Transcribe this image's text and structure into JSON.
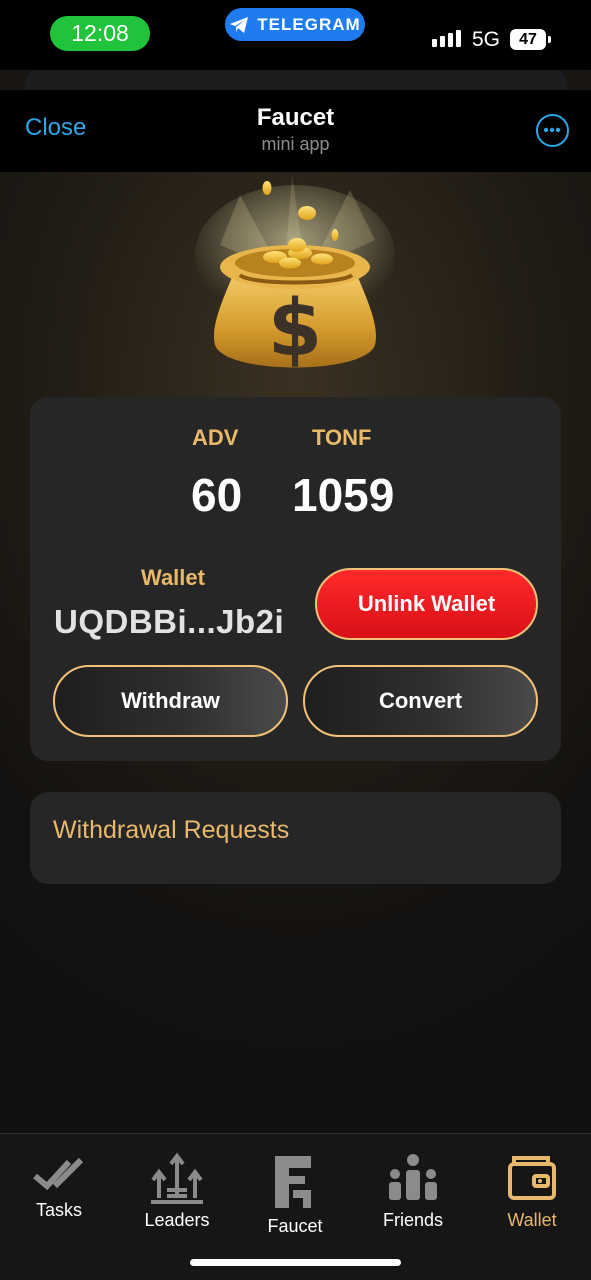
{
  "status_bar": {
    "time": "12:08",
    "telegram_label": "TELEGRAM",
    "network": "5G",
    "battery": "47"
  },
  "header": {
    "close_label": "Close",
    "title": "Faucet",
    "subtitle": "mini app",
    "more_icon": "more-dots-icon"
  },
  "balances": {
    "adv": {
      "label": "ADV",
      "value": "60"
    },
    "tonf": {
      "label": "TONF",
      "value": "1059"
    }
  },
  "wallet": {
    "label": "Wallet",
    "address": "UQDBBi...Jb2i",
    "unlink_label": "Unlink Wallet"
  },
  "actions": {
    "withdraw_label": "Withdraw",
    "convert_label": "Convert"
  },
  "withdrawal_requests": {
    "title": "Withdrawal Requests"
  },
  "tabbar": {
    "active": "wallet",
    "items": [
      {
        "label": "Tasks",
        "icon": "double-check-icon"
      },
      {
        "label": "Leaders",
        "icon": "leaderboard-icon"
      },
      {
        "label": "Faucet",
        "icon": "faucet-logo-icon"
      },
      {
        "label": "Friends",
        "icon": "friends-icon"
      },
      {
        "label": "Wallet",
        "icon": "wallet-icon"
      }
    ]
  },
  "colors": {
    "accent_gold": "#e9b96b",
    "telegram_blue": "#2aa7e8",
    "danger_red": "#e8141c",
    "status_green": "#1fc43a"
  }
}
